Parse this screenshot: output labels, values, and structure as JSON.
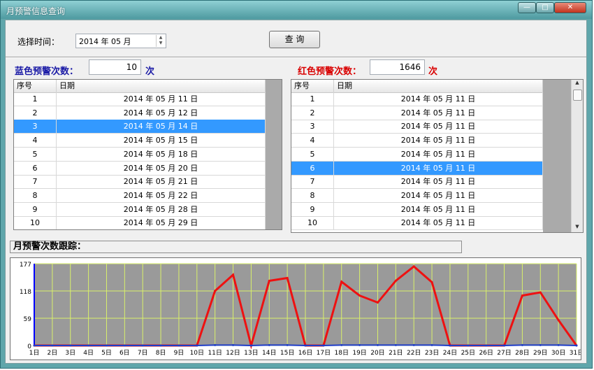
{
  "window": {
    "title": "月预警信息查询",
    "minimize": "—",
    "maximize": "□",
    "close": "✕"
  },
  "query": {
    "label": "选择时间：",
    "date_value": "2014 年 05 月",
    "button": "查 询"
  },
  "blue": {
    "label": "蓝色预警次数：",
    "count": "10",
    "unit": "次",
    "color": "#1a1aa6"
  },
  "red": {
    "label": "红色预警次数：",
    "count": "1646",
    "unit": "次",
    "color": "#d90000"
  },
  "blue_table": {
    "headers": [
      "序号",
      "日期"
    ],
    "selected_index": 2,
    "rows": [
      [
        "1",
        "2014 年 05 月 11 日"
      ],
      [
        "2",
        "2014 年 05 月 12 日"
      ],
      [
        "3",
        "2014 年 05 月 14 日"
      ],
      [
        "4",
        "2014 年 05 月 15 日"
      ],
      [
        "5",
        "2014 年 05 月 18 日"
      ],
      [
        "6",
        "2014 年 05 月 20 日"
      ],
      [
        "7",
        "2014 年 05 月 21 日"
      ],
      [
        "8",
        "2014 年 05 月 22 日"
      ],
      [
        "9",
        "2014 年 05 月 28 日"
      ],
      [
        "10",
        "2014 年 05 月 29 日"
      ]
    ]
  },
  "red_table": {
    "headers": [
      "序号",
      "日期"
    ],
    "selected_index": 5,
    "rows": [
      [
        "1",
        "2014 年 05 月 11 日"
      ],
      [
        "2",
        "2014 年 05 月 11 日"
      ],
      [
        "3",
        "2014 年 05 月 11 日"
      ],
      [
        "4",
        "2014 年 05 月 11 日"
      ],
      [
        "5",
        "2014 年 05 月 11 日"
      ],
      [
        "6",
        "2014 年 05 月 11 日"
      ],
      [
        "7",
        "2014 年 05 月 11 日"
      ],
      [
        "8",
        "2014 年 05 月 11 日"
      ],
      [
        "9",
        "2014 年 05 月 11 日"
      ],
      [
        "10",
        "2014 年 05 月 11 日"
      ]
    ]
  },
  "chart_panel_title": "月预警次数跟踪：",
  "chart_data": {
    "type": "line",
    "title": "",
    "xlabel": "",
    "ylabel": "",
    "categories": [
      "1日",
      "2日",
      "3日",
      "4日",
      "5日",
      "6日",
      "7日",
      "8日",
      "9日",
      "10日",
      "11日",
      "12日",
      "13日",
      "14日",
      "15日",
      "16日",
      "17日",
      "18日",
      "19日",
      "20日",
      "21日",
      "22日",
      "23日",
      "24日",
      "25日",
      "26日",
      "27日",
      "28日",
      "29日",
      "30日",
      "31日"
    ],
    "yticks": [
      "0",
      "59",
      "118",
      "177"
    ],
    "ylim": [
      0,
      177
    ],
    "grid": true,
    "colors": {
      "plot_bg": "#9a9a9a",
      "grid": "#d9f06a",
      "axis": "#0000ff"
    },
    "series": [
      {
        "color": "#ee1111",
        "values": [
          0,
          0,
          0,
          0,
          0,
          0,
          0,
          0,
          0,
          0,
          118,
          153,
          0,
          140,
          146,
          0,
          0,
          138,
          108,
          93,
          140,
          171,
          137,
          0,
          0,
          0,
          0,
          108,
          115,
          55,
          0
        ]
      },
      {
        "color": "#1e3cc8",
        "values": [
          0,
          0,
          0,
          0,
          0,
          0,
          0,
          0,
          0,
          0,
          1,
          1,
          0,
          1,
          1,
          0,
          0,
          1,
          1,
          1,
          1,
          1,
          1,
          0,
          0,
          0,
          0,
          1,
          1,
          1,
          0
        ]
      }
    ]
  }
}
